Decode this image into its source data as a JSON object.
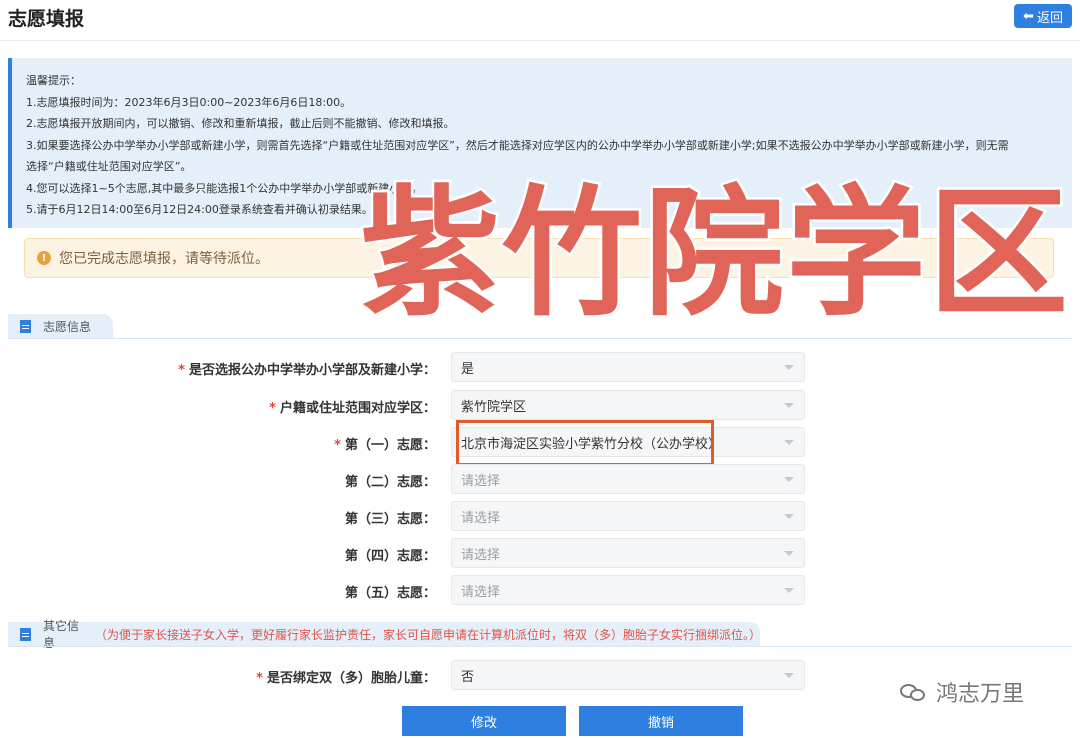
{
  "header": {
    "title": "志愿填报",
    "back_label": "返回"
  },
  "notice": {
    "lines": [
      "温馨提示：",
      "1.志愿填报时间为：2023年6月3日0:00~2023年6月6日18:00。",
      "2.志愿填报开放期间内，可以撤销、修改和重新填报，截止后则不能撤销、修改和填报。",
      "3.如果要选择公办中学举办小学部或新建小学，则需首先选择“户籍或住址范围对应学区”，然后才能选择对应学区内的公办中学举办小学部或新建小学;如果不选报公办中学举办小学部或新建小学，则无需",
      "选择“户籍或住址范围对应学区”。",
      "4.您可以选择1~5个志愿,其中最多只能选报1个公办中学举办小学部或新建小学。",
      "5.请于6月12日14:00至6月12日24:00登录系统查看并确认初录结果。"
    ]
  },
  "alert": {
    "text": "您已完成志愿填报，请等待派位。"
  },
  "section1": {
    "title": "志愿信息"
  },
  "form": {
    "rows": [
      {
        "label": "是否选报公办中学举办小学部及新建小学：",
        "required": "*",
        "value": "是"
      },
      {
        "label": "户籍或住址范围对应学区：",
        "required": "*",
        "value": "紫竹院学区"
      },
      {
        "label": "第（一）志愿：",
        "required": "*",
        "value": "北京市海淀区实验小学紫竹分校（公办学校）"
      },
      {
        "label": "第（二）志愿：",
        "required": "",
        "value": "请选择"
      },
      {
        "label": "第（三）志愿：",
        "required": "",
        "value": "请选择"
      },
      {
        "label": "第（四）志愿：",
        "required": "",
        "value": "请选择"
      },
      {
        "label": "第（五）志愿：",
        "required": "",
        "value": "请选择"
      }
    ]
  },
  "section2": {
    "title": "其它信息",
    "remark": "（为便于家长接送子女入学，更好履行家长监护责任，家长可自愿申请在计算机派位时，将双（多）胞胎子女实行捆绑派位。）"
  },
  "twins": {
    "label": "是否绑定双（多）胞胎儿童：",
    "required": "*",
    "value": "否"
  },
  "actions": {
    "modify_label": "修改",
    "cancel_label": "撤销"
  },
  "overlay": {
    "text": "紫竹院学区"
  },
  "watermark": {
    "text": "鸿志万里"
  },
  "colors": {
    "primary": "#2f7fe0",
    "required": "#e0443a",
    "overlay": "#e06458",
    "highlight": "#e55a2b"
  }
}
